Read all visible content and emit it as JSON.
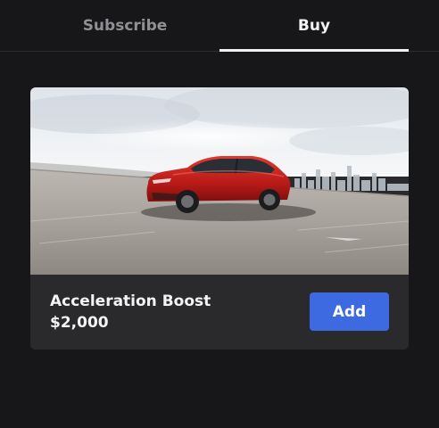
{
  "tabs": [
    {
      "label": "Subscribe",
      "active": false
    },
    {
      "label": "Buy",
      "active": true
    }
  ],
  "product": {
    "name": "Acceleration Boost",
    "price": "$2,000",
    "add_label": "Add",
    "image": "red-suv-on-road-photo"
  },
  "colors": {
    "background": "#171719",
    "card": "#2a2a2c",
    "accent_button": "#3e6ae1",
    "active_tab": "#f2f2f2",
    "inactive_tab": "#8f8f94",
    "car_body": "#c8201e"
  }
}
